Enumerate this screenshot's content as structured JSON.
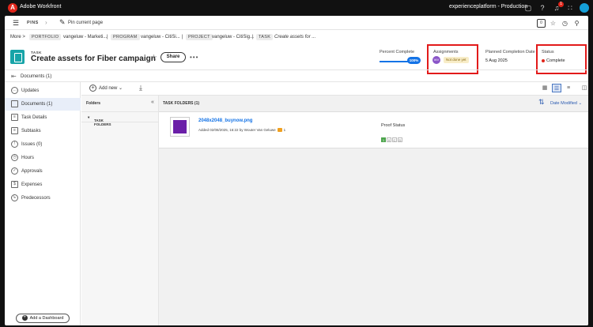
{
  "app": {
    "name": "Adobe Workfront",
    "org": "experienceplatform - Production",
    "notification_count": "1"
  },
  "pins": {
    "label": "PINS",
    "pin_current": "Pin current page"
  },
  "toolbar_icons": [
    "comment-icon",
    "help-icon",
    "bell-icon",
    "apps-grid-icon",
    "avatar"
  ],
  "pins_icons": [
    "clipboard-icon",
    "star-icon",
    "history-icon",
    "search-icon"
  ],
  "breadcrumb": {
    "more": "More >",
    "portfolio_tag": "PORTFOLIO",
    "portfolio_name": "vangeluw - Marketi...",
    "program_tag": "PROGRAM",
    "program_name": "vangeluw - CitiSi...",
    "project_tag": "PROJECT",
    "project_name": "vangeluw - CitiSig...",
    "task_tag": "TASK",
    "task_name": "Create assets for ..."
  },
  "task": {
    "type": "TASK",
    "title": "Create assets for Fiber campaign",
    "share": "Share",
    "more": "•••"
  },
  "summary": {
    "percent_label": "Percent Complete",
    "percent_value": "100%",
    "percent": 1.0,
    "assignments_label": "Assignments",
    "assignee_initials": "WV",
    "assignment_status": "Not done yet",
    "planned_label": "Planned Completion Date",
    "planned_value": "5 Aug 2025",
    "status_label": "Status",
    "status_value": "Complete",
    "status_color": "#e0261b"
  },
  "docbar": {
    "label": "Documents (1)"
  },
  "nav": [
    {
      "label": "Updates",
      "icon": "chat-icon"
    },
    {
      "label": "Documents (1)",
      "icon": "document-icon",
      "active": true
    },
    {
      "label": "Task Details",
      "icon": "details-icon"
    },
    {
      "label": "Subtasks",
      "icon": "subtasks-icon"
    },
    {
      "label": "Issues (0)",
      "icon": "issues-icon"
    },
    {
      "label": "Hours",
      "icon": "clock-icon"
    },
    {
      "label": "Approvals",
      "icon": "check-icon"
    },
    {
      "label": "Expenses",
      "icon": "money-icon"
    },
    {
      "label": "Predecessors",
      "icon": "predecessor-icon"
    }
  ],
  "dashboard_button": "Add a Dashboard",
  "doc_toolbar": {
    "add_new": "Add new"
  },
  "folders": {
    "header": "Folders",
    "task_folders": "TASK FOLDERS"
  },
  "list": {
    "header": "TASK FOLDERS (1)",
    "sort": "Date Modified",
    "items": [
      {
        "name": "2048x2048_buynow.png",
        "meta": "Added 02/08/2025, 16:22 by Wouter Van Geluwe",
        "comments": "1",
        "proof_label": "Proof Status",
        "proof_chips": [
          "1",
          "0",
          "C",
          "D"
        ]
      }
    ]
  },
  "accent_color": "#1473e6"
}
